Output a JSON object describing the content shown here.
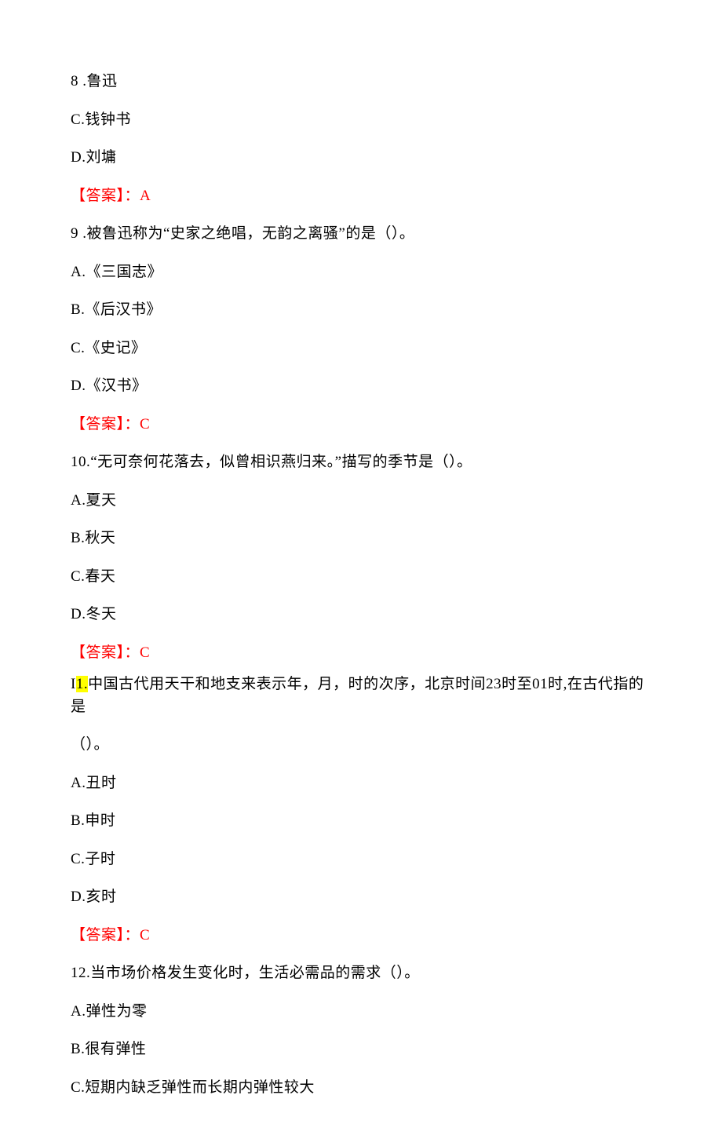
{
  "q8_partial": {
    "num_text": "8 .",
    "opt_b": "鲁迅",
    "opt_c": "C.钱钟书",
    "opt_d": "D.刘墉",
    "answer_label": "【答案】：",
    "answer_val": "A"
  },
  "q9": {
    "num_text": "9 .",
    "stem": "被鲁迅称为“史家之绝唱，无韵之离骚”的是（）。",
    "opt_a": "A.《三国志》",
    "opt_b": "B.《后汉书》",
    "opt_c": "C.《史记》",
    "opt_d": "D.《汉书》",
    "answer_label": "【答案】：",
    "answer_val": "C"
  },
  "q10": {
    "stem": "10.“无可奈何花落去，似曾相识燕归来。”描写的季节是（）。",
    "opt_a": "A.夏天",
    "opt_b": "B.秋天",
    "opt_c": "C.春天",
    "opt_d": "D.冬天",
    "answer_label": "【答案】：",
    "answer_val": "C"
  },
  "q11": {
    "prefix": "I",
    "hl": "1.",
    "stem_part1": "中国古代用天干和地支来表示年，月，时的次序，北京时间23时至01时,在古代指的是",
    "stem_part2": "（）。",
    "opt_a": "A.丑时",
    "opt_b": "B.申时",
    "opt_c": "C.子时",
    "opt_d": "D.亥时",
    "answer_label": "【答案】：",
    "answer_val": "C"
  },
  "q12": {
    "stem": "12.当市场价格发生变化时，生活必需品的需求（）。",
    "opt_a": "A.弹性为零",
    "opt_b": "B.很有弹性",
    "opt_c": "C.短期内缺乏弹性而长期内弹性较大"
  }
}
